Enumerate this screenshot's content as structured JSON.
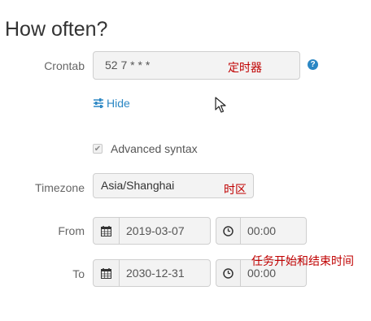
{
  "section_title": "How often?",
  "crontab": {
    "label": "Crontab",
    "value": "52 7 * * *",
    "annotation": "定时器"
  },
  "hide_link": "Hide",
  "advanced": {
    "label": "Advanced syntax",
    "checked": true
  },
  "timezone": {
    "label": "Timezone",
    "value": "Asia/Shanghai",
    "annotation": "时区"
  },
  "from": {
    "label": "From",
    "date": "2019-03-07",
    "time": "00:00"
  },
  "to": {
    "label": "To",
    "date": "2030-12-31",
    "time": "00:00"
  },
  "range_annotation": "任务开始和结束时间",
  "icons": {
    "help": "question-circle-icon",
    "hide": "sliders-icon",
    "date": "calendar-icon",
    "time": "clock-icon",
    "pointer": "mouse-cursor-icon"
  },
  "colors": {
    "link": "#2b87c4",
    "annotation": "#c00000"
  }
}
